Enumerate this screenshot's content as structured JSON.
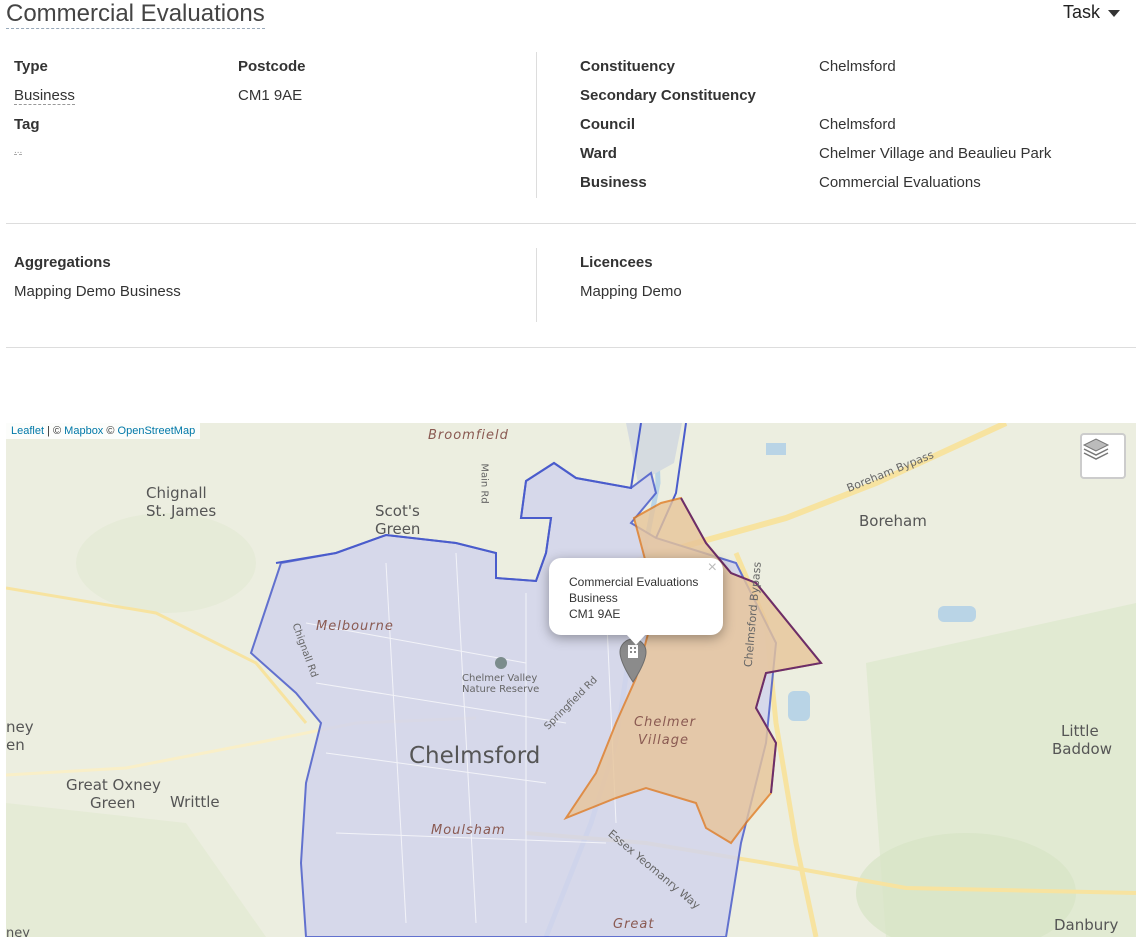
{
  "header": {
    "title": "Commercial Evaluations",
    "task_label": "Task"
  },
  "details": {
    "type_label": "Type",
    "type_value": "Business",
    "postcode_label": "Postcode",
    "postcode_value": "CM1 9AE",
    "tag_label": "Tag",
    "tag_value": "...",
    "constituency_label": "Constituency",
    "constituency_value": "Chelmsford",
    "secondary_constituency_label": "Secondary Constituency",
    "council_label": "Council",
    "council_value": "Chelmsford",
    "ward_label": "Ward",
    "ward_value": "Chelmer Village and Beaulieu Park",
    "business_label": "Business",
    "business_value": "Commercial Evaluations"
  },
  "relations": {
    "aggregations_label": "Aggregations",
    "aggregations_value": "Mapping Demo Business",
    "licencees_label": "Licencees",
    "licencees_value": "Mapping Demo"
  },
  "map": {
    "attribution_leaflet": "Leaflet",
    "attribution_sep1": " | © ",
    "attribution_mapbox": "Mapbox",
    "attribution_sep2": " © ",
    "attribution_osm": "OpenStreetMap",
    "popup": {
      "line1": "Commercial Evaluations",
      "line2": "Business",
      "line3": "CM1 9AE",
      "close": "×"
    },
    "labels": {
      "broomfield": "Broomfield",
      "chignall": "Chignall",
      "st_james": "St. James",
      "scots": "Scot's",
      "green": "Green",
      "boreham": "Boreham",
      "boreham_bypass": "Boreham Bypass",
      "melbourne": "Melbourne",
      "chignall_rd": "Chignall Rd",
      "main_rd": "Main Rd",
      "chelmer_valley_1": "Chelmer Valley",
      "chelmer_valley_2": "Nature Reserve",
      "springfield_rd": "Springfield Rd",
      "chelmsford": "Chelmsford",
      "chelmer": "Chelmer",
      "village": "Village",
      "chelmsford_bypass": "Chelmsford Bypass",
      "little": "Little",
      "baddow": "Baddow",
      "honey": "ney",
      "hen": "en",
      "great_oxney": "Great Oxney",
      "oxney_green": "Green",
      "writtle": "Writtle",
      "moulsham": "Moulsham",
      "essex_yeomanry": "Essex Yeomanry Way",
      "great": "Great",
      "danbury": "Danbury",
      "bottom_ney": "ney"
    }
  },
  "colors": {
    "link": "#2a6ebb",
    "constituency_outline": "#4a5ccc",
    "ward_fill": "#e8c59a",
    "ward_outline": "#e07b20",
    "council_outline": "#6b2e6b"
  }
}
